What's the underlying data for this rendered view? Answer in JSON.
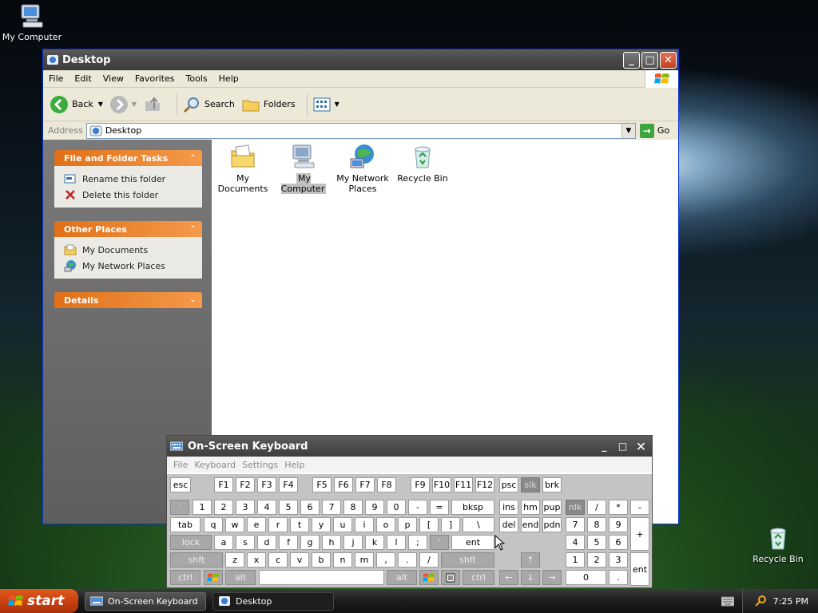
{
  "desktop": {
    "icons": [
      {
        "label": "My Computer",
        "icon": "my-computer-icon"
      },
      {
        "label": "Recycle Bin",
        "icon": "recycle-bin-icon"
      }
    ]
  },
  "explorer": {
    "title": "Desktop",
    "menu": [
      "File",
      "Edit",
      "View",
      "Favorites",
      "Tools",
      "Help"
    ],
    "toolbar": {
      "back": "Back",
      "search": "Search",
      "folders": "Folders"
    },
    "address": {
      "label": "Address",
      "value": "Desktop",
      "go": "Go"
    },
    "tasks": {
      "file_folder": {
        "title": "File and Folder Tasks",
        "items": [
          "Rename this folder",
          "Delete this folder"
        ]
      },
      "other": {
        "title": "Other Places",
        "items": [
          "My Documents",
          "My Network Places"
        ]
      },
      "details": {
        "title": "Details"
      }
    },
    "files": [
      "My Documents",
      "My Computer",
      "My Network Places",
      "Recycle Bin"
    ]
  },
  "osk": {
    "title": "On-Screen Keyboard",
    "menu": [
      "File",
      "Keyboard",
      "Settings",
      "Help"
    ],
    "keys": {
      "esc": "esc",
      "f1": "F1",
      "f2": "F2",
      "f3": "F3",
      "f4": "F4",
      "f5": "F5",
      "f6": "F6",
      "f7": "F7",
      "f8": "F8",
      "f9": "F9",
      "f10": "F10",
      "f11": "F11",
      "f12": "F12",
      "psc": "psc",
      "slk": "slk",
      "brk": "brk",
      "tick": "`",
      "n1": "1",
      "n2": "2",
      "n3": "3",
      "n4": "4",
      "n5": "5",
      "n6": "6",
      "n7": "7",
      "n8": "8",
      "n9": "9",
      "n0": "0",
      "minus": "-",
      "equals": "=",
      "bksp": "bksp",
      "ins": "ins",
      "hm": "hm",
      "pup": "pup",
      "nlk": "nlk",
      "slash": "/",
      "star": "*",
      "kminus": "-",
      "tab": "tab",
      "q": "q",
      "w": "w",
      "e": "e",
      "r": "r",
      "t": "t",
      "y": "y",
      "u": "u",
      "i": "i",
      "o": "o",
      "p": "p",
      "lbr": "[",
      "rbr": "]",
      "bslash": "\\",
      "del": "del",
      "end": "end",
      "pdn": "pdn",
      "k7": "7",
      "k8": "8",
      "k9": "9",
      "plus": "+",
      "lock": "lock",
      "a": "a",
      "s": "s",
      "d": "d",
      "f": "f",
      "g": "g",
      "h": "h",
      "j": "j",
      "k": "k",
      "l": "l",
      "semi": ";",
      "quote": "'",
      "ent": "ent",
      "k4": "4",
      "k5": "5",
      "k6": "6",
      "shft": "shft",
      "z": "z",
      "x": "x",
      "c": "c",
      "v": "v",
      "b": "b",
      "n": "n",
      "m": "m",
      "comma": ",",
      "period": ".",
      "fslash": "/",
      "shft2": "shft",
      "up": "↑",
      "k1": "1",
      "k2": "2",
      "k3": "3",
      "kent": "ent",
      "ctrl": "ctrl",
      "alt": "alt",
      "alt2": "alt",
      "ctrl2": "ctrl",
      "left": "←",
      "down": "↓",
      "right": "→",
      "k0": "0",
      "kdot": "."
    }
  },
  "taskbar": {
    "start": "start",
    "tasks": [
      "On-Screen Keyboard",
      "Desktop"
    ],
    "clock": "7:25 PM"
  }
}
